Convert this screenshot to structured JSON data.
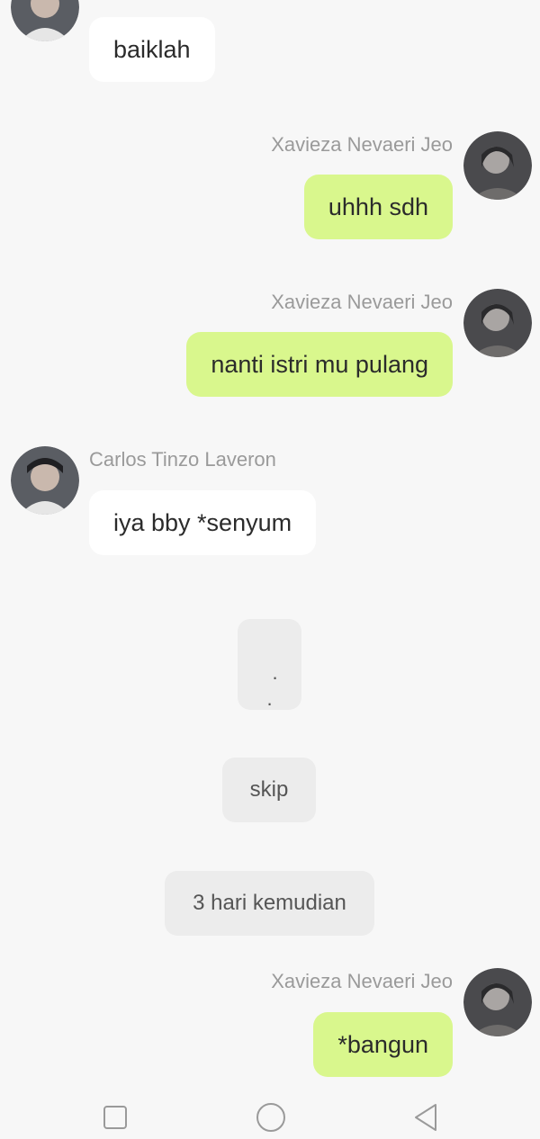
{
  "messages": [
    {
      "sender": "",
      "text": "baiklah",
      "side": "left"
    },
    {
      "sender": "Xavieza Nevaeri Jeo",
      "text": "uhhh sdh",
      "side": "right"
    },
    {
      "sender": "Xavieza Nevaeri Jeo",
      "text": "nanti istri mu pulang",
      "side": "right"
    },
    {
      "sender": "Carlos Tinzo Laveron",
      "text": "iya bby *senyum",
      "side": "left"
    },
    {
      "sender": "Xavieza Nevaeri Jeo",
      "text": "*bangun",
      "side": "right"
    }
  ],
  "system": {
    "dots": ".\n.",
    "skip": "skip",
    "time_note": "3 hari kemudian"
  },
  "nav": {
    "icons": [
      "recent-apps-icon",
      "home-icon",
      "back-icon"
    ]
  },
  "colors": {
    "background": "#f7f7f7",
    "bubble_white": "#ffffff",
    "bubble_green": "#d9f78d",
    "system_bubble": "#ececec",
    "name_text": "#9a9a9a",
    "message_text": "#2b2b2b"
  }
}
